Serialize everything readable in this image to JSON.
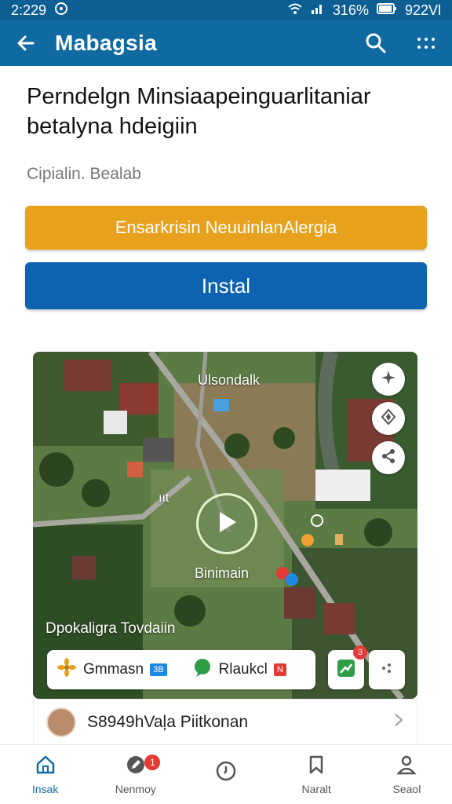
{
  "status": {
    "time": "2:229",
    "battery": "316%",
    "signal_text": "922Vl"
  },
  "app_bar": {
    "title": "Mabagsia"
  },
  "content": {
    "headline": "Perndelgn Minsiaapeinguarlitaniar betalyna hdeigiin",
    "subtext": "Cipialin. Bealab",
    "primary_button": "Ensarkrisin NeuuinlanAlergia",
    "install_button": "Instal"
  },
  "map": {
    "top_label": "Ulsondalk",
    "center_label": "Binimain",
    "bottom_label": "Dpokaligra Tovdaiin",
    "counter_text": "ııt",
    "chips": [
      {
        "label": "Gmmasn",
        "badge": "3B",
        "badge_color": "#1e88e5"
      },
      {
        "label": "Rlaukcl",
        "badge": "N",
        "badge_color": "#e53935"
      }
    ],
    "notify_count": "3"
  },
  "row": {
    "text": "S8949hVaļa Piitkonan"
  },
  "nav": {
    "items": [
      {
        "label": "Insak",
        "icon": "home-icon",
        "active": true
      },
      {
        "label": "Nenmoy",
        "icon": "edit-icon",
        "active": false,
        "badge": "1"
      },
      {
        "label": "",
        "icon": "clock-icon",
        "active": false
      },
      {
        "label": "Naralt",
        "icon": "bookmark-icon",
        "active": false
      },
      {
        "label": "Seaol",
        "icon": "person-icon",
        "active": false
      }
    ]
  },
  "colors": {
    "primary": "#0f6aa2",
    "accent_orange": "#e8a11d",
    "accent_blue": "#0d63b0"
  }
}
